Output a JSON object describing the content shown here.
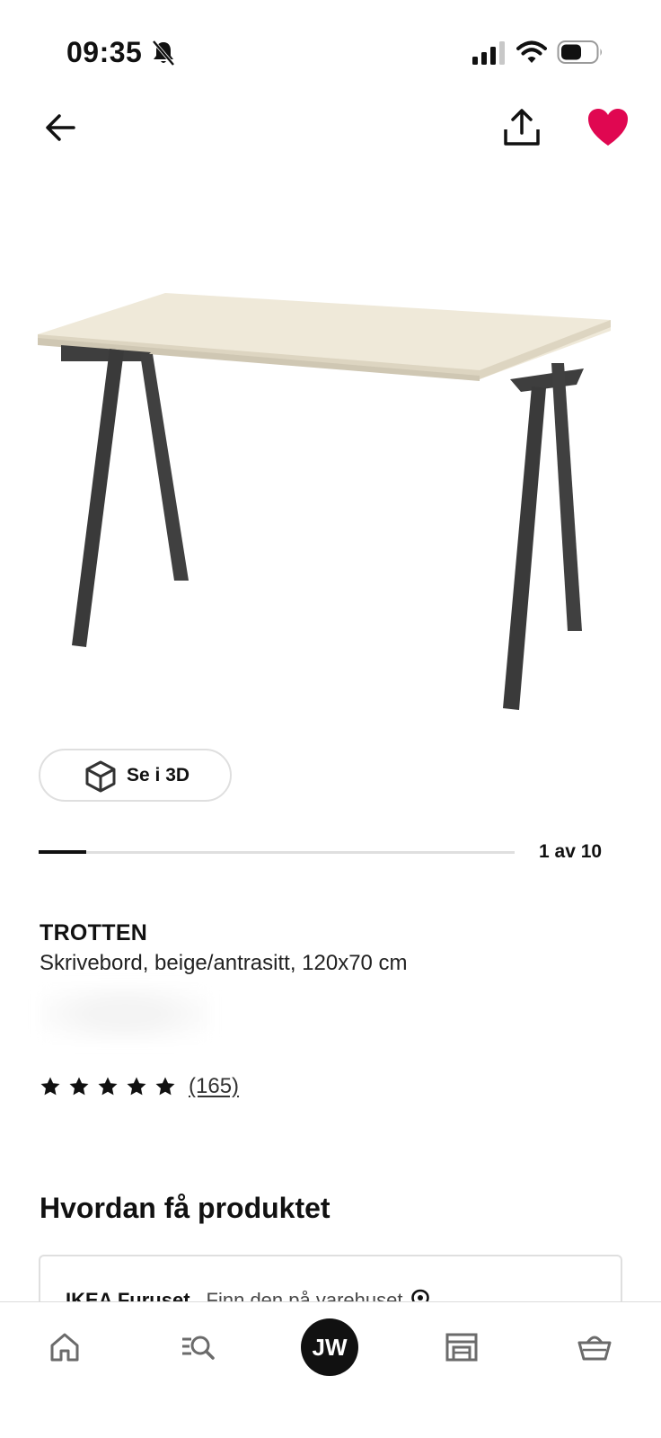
{
  "status_bar": {
    "time": "09:35",
    "icons": [
      "bell-muted-icon",
      "cellular-signal-icon",
      "wifi-icon",
      "battery-icon"
    ]
  },
  "header": {
    "icons": [
      "back-arrow-icon",
      "share-icon",
      "heart-icon"
    ],
    "favorite_color": "#e00751"
  },
  "gallery": {
    "view_3d_label": "Se i 3D",
    "counter": "1 av 10",
    "current": 1,
    "total": 10
  },
  "product": {
    "name": "TROTTEN",
    "description": "Skrivebord, beige/antrasitt, 120x70 cm",
    "rating_stars": 5,
    "review_count": "(165)"
  },
  "availability": {
    "title": "Hvordan få produktet",
    "store_name": "IKEA Furuset",
    "store_action": "Finn den på varehuset"
  },
  "tab_bar": {
    "items": [
      "home-icon",
      "search-icon",
      "avatar",
      "store-icon",
      "cart-icon"
    ],
    "avatar_initials": "JW"
  }
}
